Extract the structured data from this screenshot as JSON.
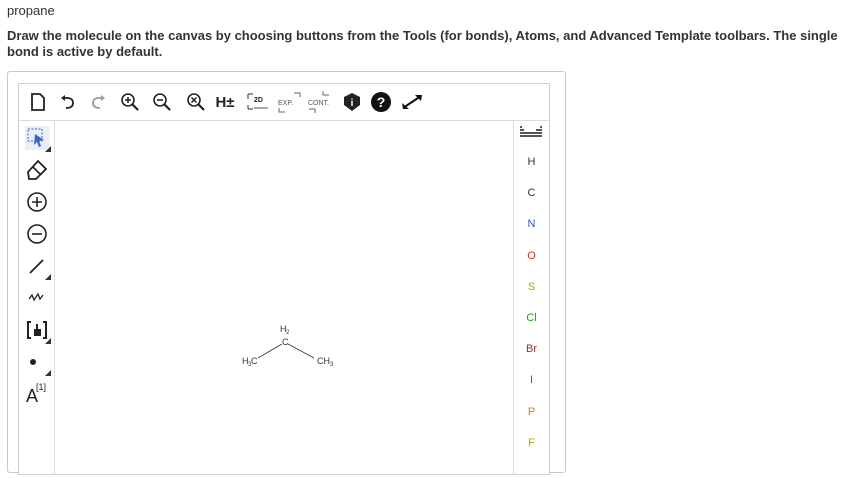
{
  "question": {
    "title": "propane",
    "instructions": "Draw the molecule on the canvas by choosing buttons from the Tools (for bonds), Atoms, and Advanced Template toolbars. The single bond is active by default."
  },
  "top_toolbar": [
    {
      "name": "new-document-icon"
    },
    {
      "name": "undo-icon"
    },
    {
      "name": "redo-icon"
    },
    {
      "name": "zoom-in-icon"
    },
    {
      "name": "zoom-out-icon"
    },
    {
      "name": "reset-zoom-icon"
    },
    {
      "name": "hydrogen-toggle-icon",
      "label": "H±"
    },
    {
      "name": "clean-2d-icon",
      "label": "2D"
    },
    {
      "name": "expand-icon",
      "label": "EXP."
    },
    {
      "name": "contract-icon",
      "label": "CONT."
    },
    {
      "name": "info-icon",
      "label": "i"
    },
    {
      "name": "help-icon",
      "label": "?"
    },
    {
      "name": "fullscreen-icon"
    }
  ],
  "left_toolbar": [
    {
      "name": "select-tool-icon"
    },
    {
      "name": "erase-tool-icon"
    },
    {
      "name": "charge-plus-icon"
    },
    {
      "name": "charge-minus-icon"
    },
    {
      "name": "single-bond-icon"
    },
    {
      "name": "chain-tool-icon"
    },
    {
      "name": "bracket-tool-icon"
    },
    {
      "name": "radical-dot-icon"
    },
    {
      "name": "atom-label-icon",
      "label": "A",
      "superscript": "[1]"
    }
  ],
  "atoms": [
    {
      "symbol": "H",
      "color": "#333333"
    },
    {
      "symbol": "C",
      "color": "#333333"
    },
    {
      "symbol": "N",
      "color": "#3050c8"
    },
    {
      "symbol": "O",
      "color": "#d03030"
    },
    {
      "symbol": "S",
      "color": "#b8a000"
    },
    {
      "symbol": "Cl",
      "color": "#20a020"
    },
    {
      "symbol": "Br",
      "color": "#8b3a2a"
    },
    {
      "symbol": "I",
      "color": "#8a2be2"
    },
    {
      "symbol": "P",
      "color": "#e08000"
    },
    {
      "symbol": "F",
      "color": "#b8a000"
    }
  ],
  "molecule": {
    "left": {
      "main": "H",
      "sub": "3",
      "end": "C"
    },
    "middle": {
      "main": "H",
      "sub": "2",
      "below": "C"
    },
    "right": {
      "main": "CH",
      "sub": "3"
    }
  }
}
